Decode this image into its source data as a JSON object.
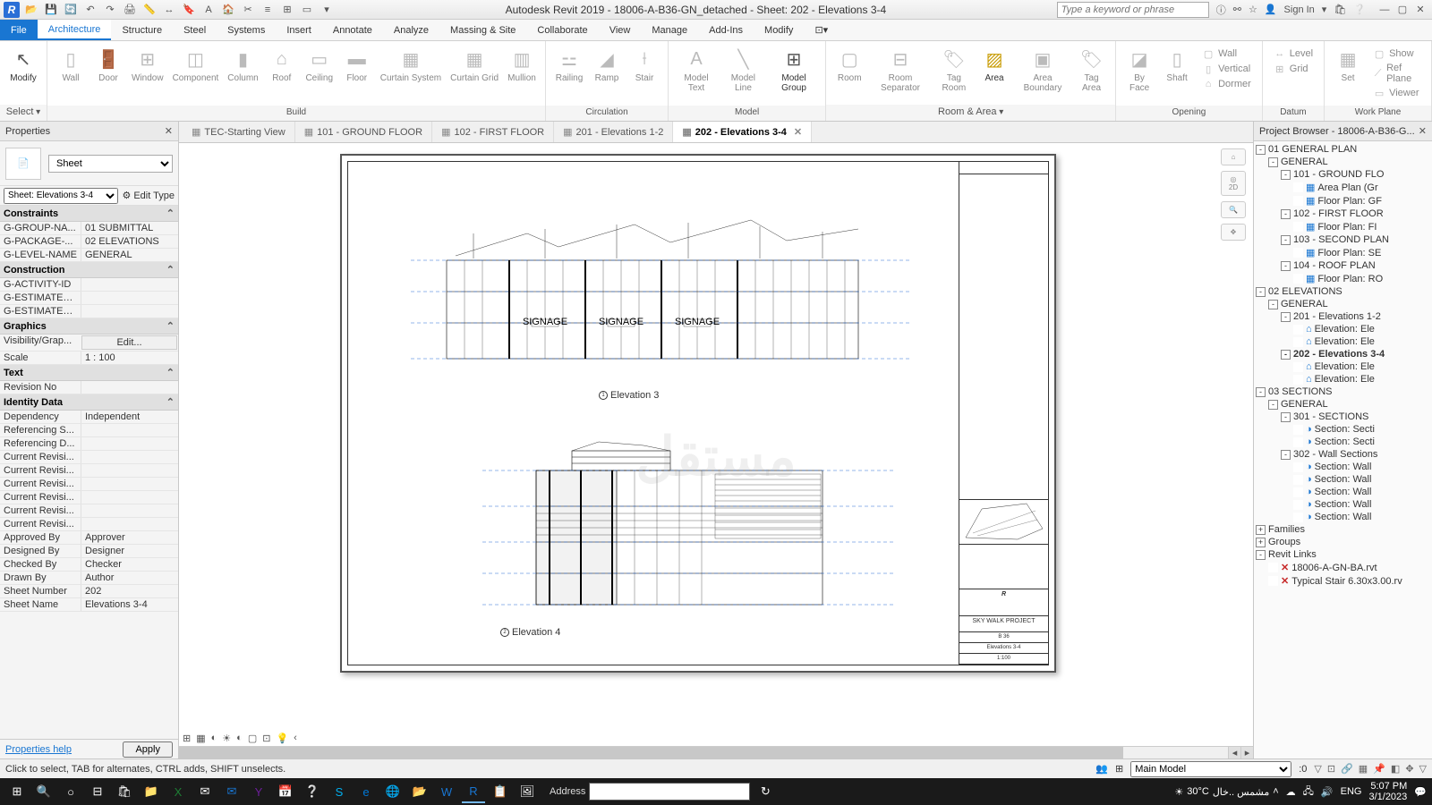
{
  "titlebar": {
    "app_title": "Autodesk Revit 2019 - 18006-A-B36-GN_detached - Sheet: 202 - Elevations 3-4",
    "search_placeholder": "Type a keyword or phrase",
    "signin": "Sign In"
  },
  "menu": {
    "items": [
      "File",
      "Architecture",
      "Structure",
      "Steel",
      "Systems",
      "Insert",
      "Annotate",
      "Analyze",
      "Massing & Site",
      "Collaborate",
      "View",
      "Manage",
      "Add-Ins",
      "Modify"
    ],
    "active": "Architecture"
  },
  "ribbon": {
    "select": {
      "modify": "Modify",
      "panel": "Select"
    },
    "build": {
      "items": [
        "Wall",
        "Door",
        "Window",
        "Component",
        "Column",
        "Roof",
        "Ceiling",
        "Floor",
        "Curtain System",
        "Curtain Grid",
        "Mullion"
      ],
      "panel": "Build"
    },
    "circulation": {
      "items": [
        "Railing",
        "Ramp",
        "Stair"
      ],
      "panel": "Circulation"
    },
    "model": {
      "items": [
        "Model Text",
        "Model Line",
        "Model Group"
      ],
      "panel": "Model"
    },
    "roomarea": {
      "items": [
        "Room",
        "Room Separator",
        "Tag Room",
        "Area",
        "Area Boundary",
        "Tag Area"
      ],
      "panel": "Room & Area"
    },
    "opening": {
      "items": [
        "By Face",
        "Shaft",
        "Wall",
        "Vertical",
        "Dormer"
      ],
      "panel": "Opening"
    },
    "datum": {
      "items": [
        "Level",
        "Grid"
      ],
      "panel": "Datum"
    },
    "workplane": {
      "items": [
        "Set",
        "Show",
        "Ref Plane",
        "Viewer"
      ],
      "panel": "Work Plane"
    }
  },
  "properties": {
    "title": "Properties",
    "type": "Sheet",
    "instance_selector": "Sheet: Elevations 3-4",
    "edit_type": "Edit Type",
    "categories": [
      {
        "name": "Constraints",
        "rows": [
          {
            "k": "G-GROUP-NA...",
            "v": "01 SUBMITTAL"
          },
          {
            "k": "G-PACKAGE-...",
            "v": "02 ELEVATIONS"
          },
          {
            "k": "G-LEVEL-NAME",
            "v": "GENERAL"
          }
        ]
      },
      {
        "name": "Construction",
        "rows": [
          {
            "k": "G-ACTIVITY-ID",
            "v": ""
          },
          {
            "k": "G-ESTIMATED...",
            "v": ""
          },
          {
            "k": "G-ESTIMATED...",
            "v": ""
          }
        ]
      },
      {
        "name": "Graphics",
        "rows": [
          {
            "k": "Visibility/Grap...",
            "v": "Edit...",
            "btn": true
          },
          {
            "k": "Scale",
            "v": "1 : 100"
          }
        ]
      },
      {
        "name": "Text",
        "rows": [
          {
            "k": "Revision No",
            "v": ""
          }
        ]
      },
      {
        "name": "Identity Data",
        "rows": [
          {
            "k": "Dependency",
            "v": "Independent"
          },
          {
            "k": "Referencing S...",
            "v": ""
          },
          {
            "k": "Referencing D...",
            "v": ""
          },
          {
            "k": "Current Revisi...",
            "v": ""
          },
          {
            "k": "Current Revisi...",
            "v": ""
          },
          {
            "k": "Current Revisi...",
            "v": ""
          },
          {
            "k": "Current Revisi...",
            "v": ""
          },
          {
            "k": "Current Revisi...",
            "v": ""
          },
          {
            "k": "Current Revisi...",
            "v": ""
          },
          {
            "k": "Approved By",
            "v": "Approver"
          },
          {
            "k": "Designed By",
            "v": "Designer"
          },
          {
            "k": "Checked By",
            "v": "Checker"
          },
          {
            "k": "Drawn By",
            "v": "Author"
          },
          {
            "k": "Sheet Number",
            "v": "202"
          },
          {
            "k": "Sheet Name",
            "v": "Elevations 3-4"
          }
        ]
      }
    ],
    "help": "Properties help",
    "apply": "Apply"
  },
  "viewtabs": {
    "tabs": [
      {
        "label": "TEC-Starting View"
      },
      {
        "label": "101 - GROUND FLOOR"
      },
      {
        "label": "102 - FIRST FLOOR"
      },
      {
        "label": "201 - Elevations  1-2"
      },
      {
        "label": "202 - Elevations 3-4",
        "active": true
      }
    ]
  },
  "sheet": {
    "elev3_title": "Elevation 3",
    "elev4_title": "Elevation 4",
    "signage": "SIGNAGE",
    "project": "SKY WALK PROJECT",
    "block": "B 36",
    "sheetname": "Elevations 3-4",
    "scale": "1:100"
  },
  "browser": {
    "title": "Project Browser - 18006-A-B36-G...",
    "items": [
      {
        "ind": 0,
        "tog": "-",
        "label": "01 GENERAL PLAN"
      },
      {
        "ind": 1,
        "tog": "-",
        "label": "GENERAL"
      },
      {
        "ind": 2,
        "tog": "-",
        "label": "101 - GROUND FLO"
      },
      {
        "ind": 3,
        "icon": "▦",
        "label": "Area Plan (Gr"
      },
      {
        "ind": 3,
        "icon": "▦",
        "label": "Floor Plan: GF"
      },
      {
        "ind": 2,
        "tog": "-",
        "label": "102 - FIRST FLOOR"
      },
      {
        "ind": 3,
        "icon": "▦",
        "label": "Floor Plan: FI"
      },
      {
        "ind": 2,
        "tog": "-",
        "label": "103 - SECOND PLAN"
      },
      {
        "ind": 3,
        "icon": "▦",
        "label": "Floor Plan: SE"
      },
      {
        "ind": 2,
        "tog": "-",
        "label": "104 - ROOF PLAN"
      },
      {
        "ind": 3,
        "icon": "▦",
        "label": "Floor Plan: RO"
      },
      {
        "ind": 0,
        "tog": "-",
        "label": "02 ELEVATIONS"
      },
      {
        "ind": 1,
        "tog": "-",
        "label": "GENERAL"
      },
      {
        "ind": 2,
        "tog": "-",
        "label": "201 - Elevations  1-2"
      },
      {
        "ind": 3,
        "icon": "⌂",
        "label": "Elevation: Ele"
      },
      {
        "ind": 3,
        "icon": "⌂",
        "label": "Elevation: Ele"
      },
      {
        "ind": 2,
        "tog": "-",
        "label": "202 - Elevations 3-4",
        "bold": true
      },
      {
        "ind": 3,
        "icon": "⌂",
        "label": "Elevation: Ele"
      },
      {
        "ind": 3,
        "icon": "⌂",
        "label": "Elevation: Ele"
      },
      {
        "ind": 0,
        "tog": "-",
        "label": "03 SECTIONS"
      },
      {
        "ind": 1,
        "tog": "-",
        "label": "GENERAL"
      },
      {
        "ind": 2,
        "tog": "-",
        "label": "301 - SECTIONS"
      },
      {
        "ind": 3,
        "icon": "◑",
        "label": "Section: Secti"
      },
      {
        "ind": 3,
        "icon": "◑",
        "label": "Section: Secti"
      },
      {
        "ind": 2,
        "tog": "-",
        "label": "302 - Wall Sections"
      },
      {
        "ind": 3,
        "icon": "◑",
        "label": "Section: Wall"
      },
      {
        "ind": 3,
        "icon": "◑",
        "label": "Section: Wall"
      },
      {
        "ind": 3,
        "icon": "◑",
        "label": "Section: Wall"
      },
      {
        "ind": 3,
        "icon": "◑",
        "label": "Section: Wall"
      },
      {
        "ind": 3,
        "icon": "◑",
        "label": "Section: Wall"
      },
      {
        "ind": 0,
        "tog": "+",
        "icon": "",
        "label": "Families"
      },
      {
        "ind": 0,
        "tog": "+",
        "icon": "",
        "label": "Groups"
      },
      {
        "ind": 0,
        "tog": "-",
        "icon": "",
        "label": "Revit Links"
      },
      {
        "ind": 1,
        "redx": true,
        "label": "18006-A-GN-BA.rvt"
      },
      {
        "ind": 1,
        "redx": true,
        "label": "Typical Stair 6.30x3.00.rv"
      }
    ]
  },
  "status": {
    "hint": "Click to select, TAB for alternates, CTRL adds, SHIFT unselects.",
    "workset": "Main Model",
    "sel": ":0"
  },
  "taskbar": {
    "address": "Address",
    "temp": "30°C",
    "weather_text": "مشمس ..خال",
    "lang": "ENG",
    "time": "5:07 PM",
    "date": "3/1/2023"
  },
  "watermark": "مستقل"
}
